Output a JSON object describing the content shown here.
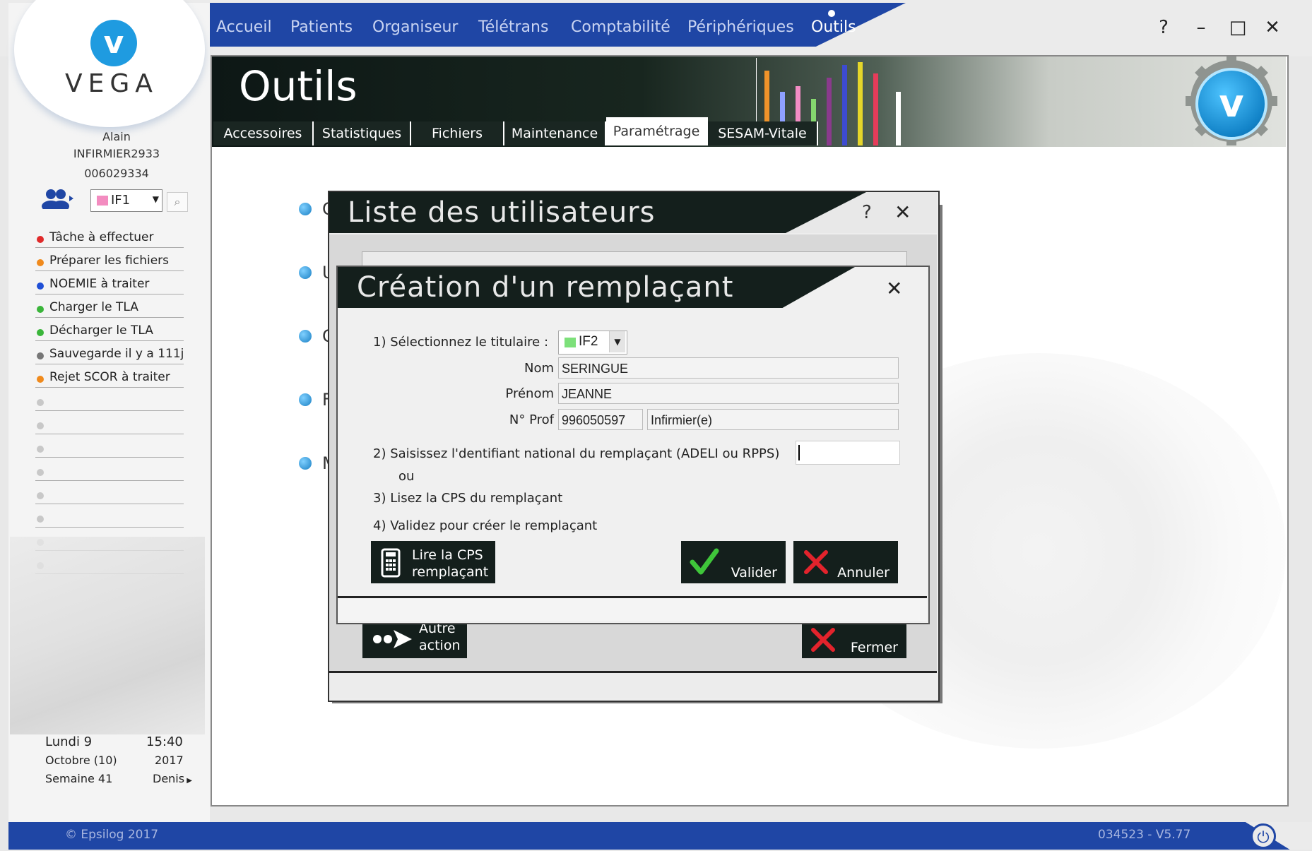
{
  "topnav": {
    "items": [
      "Accueil",
      "Patients",
      "Organiseur",
      "Télétrans",
      "Comptabilité",
      "Périphériques",
      "Outils"
    ],
    "active": "Outils",
    "help": "?",
    "minimize": "–",
    "maximize": "□",
    "close": "✕"
  },
  "sidebar": {
    "logo": "VEGA",
    "user": {
      "first_name": "Alain",
      "login": "INFIRMIER2933",
      "number": "006029334"
    },
    "user_select": "IF1",
    "tasks": [
      {
        "label": "Tâche à effectuer",
        "color": "#e02a2a"
      },
      {
        "label": "Préparer les fichiers",
        "color": "#f08a1c"
      },
      {
        "label": "NOEMIE à traiter",
        "color": "#1f4fd6"
      },
      {
        "label": "Charger le TLA",
        "color": "#3ab53a"
      },
      {
        "label": "Décharger le TLA",
        "color": "#3ab53a"
      },
      {
        "label": "Sauvegarde il y a 111j",
        "color": "#777777"
      },
      {
        "label": "Rejet SCOR à traiter",
        "color": "#f08a1c"
      }
    ],
    "date": {
      "day": "Lundi 9",
      "time": "15:40",
      "month": "Octobre (10)",
      "year": "2017",
      "week": "Semaine 41",
      "saint": "Denis"
    }
  },
  "main": {
    "title": "Outils",
    "tabs": [
      "Accessoires",
      "Statistiques",
      "Fichiers",
      "Maintenance",
      "Paramétrage",
      "SESAM-Vitale"
    ],
    "active_tab": "Paramétrage",
    "list_initials": [
      "C",
      "U",
      "C",
      "F",
      "M"
    ]
  },
  "dialog_users": {
    "title": "Liste des utilisateurs",
    "help": "?",
    "close": "✕",
    "other_action": "Autre action",
    "close_button": "Fermer"
  },
  "dialog_create": {
    "title": "Création d'un remplaçant",
    "close": "✕",
    "step1_label": "1) Sélectionnez le titulaire :",
    "titulaire": "IF2",
    "nom_label": "Nom",
    "nom": "SERINGUE",
    "prenom_label": "Prénom",
    "prenom": "JEANNE",
    "nprof_label": "N° Prof",
    "nprof": "996050597",
    "profession": "Infirmier(e)",
    "step2_label": "2) Saisissez l'dentifiant national du remplaçant (ADELI ou RPPS)",
    "adeli_value": "",
    "or_label": "ou",
    "step3_label": "3) Lisez la CPS du remplaçant",
    "step4_label": "4) Validez pour créer le remplaçant",
    "read_cps": "Lire la CPS remplaçant",
    "validate": "Valider",
    "cancel": "Annuler"
  },
  "footer": {
    "copyright": "© Epsilog 2017",
    "version": "034523 - V5.77"
  },
  "colors": {
    "nav_blue": "#1f46a5",
    "header_dark": "#141f1c",
    "accent_cyan": "#1f9be0",
    "validate_green": "#3fc63a",
    "cancel_red": "#e3232c"
  }
}
